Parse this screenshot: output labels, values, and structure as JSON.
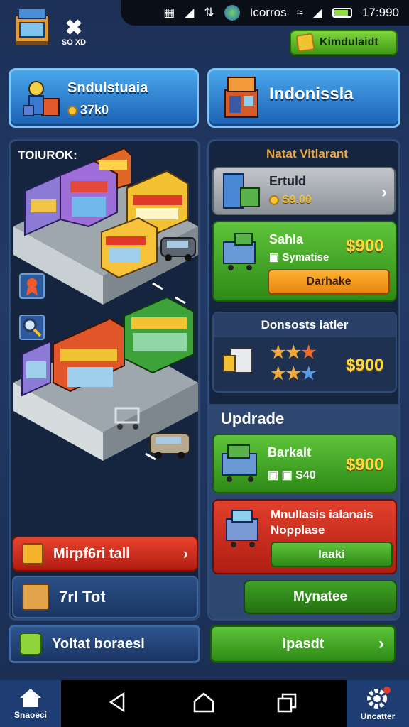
{
  "status_bar": {
    "label": "Icorros",
    "time": "17:990"
  },
  "header": {
    "close_caption": "SO XD",
    "top_button": "Kimdulaidt"
  },
  "cards": {
    "left": {
      "title": "Sndulstuaia",
      "coins": "37k0"
    },
    "right": {
      "title": "Indonissla"
    }
  },
  "town": {
    "label": "TOIUROK:",
    "red_button": "Mirpf6ri tall",
    "blue_button": "7rl Tot",
    "bottom_button": "Yoltat boraesl"
  },
  "shop": {
    "title": "Natat Vitlarant",
    "item1": {
      "name": "Ertuld",
      "price": "S9.00"
    },
    "item2": {
      "name": "Sahla",
      "sub": "Symatise",
      "price": "$900",
      "button": "Darhake"
    },
    "item3": {
      "name": "Donsosts iatler",
      "price": "$900"
    },
    "upgrade_label": "Updrade",
    "item4": {
      "name": "Barkalt",
      "sub": "S40",
      "price": "$900"
    },
    "item5": {
      "name": "Mnullasis ialanais",
      "sub": "Nopplase",
      "button": "laaki"
    },
    "button_mid": "Mynatee",
    "button_bottom": "lpasdt"
  },
  "nav": {
    "home_label": "Snaoeci",
    "settings_label": "Uncatter"
  }
}
